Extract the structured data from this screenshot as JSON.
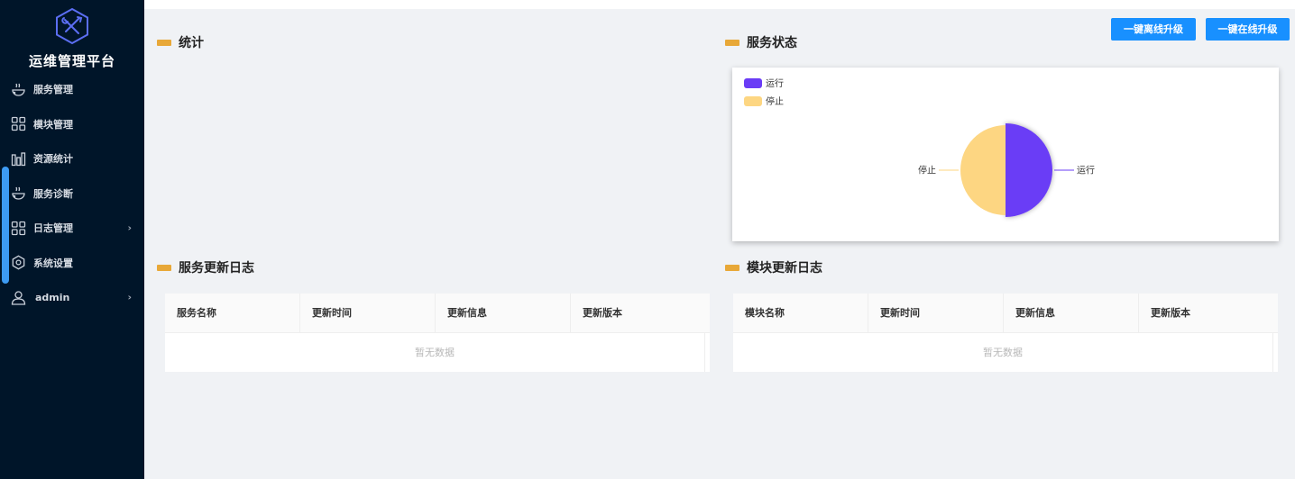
{
  "app": {
    "title": "运维管理平台"
  },
  "sidebar": {
    "items": [
      {
        "label": "服务管理",
        "icon": "service-bowl-icon",
        "has_arrow": false
      },
      {
        "label": "模块管理",
        "icon": "grid-icon",
        "has_arrow": false
      },
      {
        "label": "资源统计",
        "icon": "bar-chart-icon",
        "has_arrow": false
      },
      {
        "label": "服务诊断",
        "icon": "service-bowl-icon",
        "has_arrow": false
      },
      {
        "label": "日志管理",
        "icon": "grid-icon",
        "has_arrow": true
      },
      {
        "label": "系统设置",
        "icon": "gear-icon",
        "has_arrow": false
      },
      {
        "label": "admin",
        "icon": "user-icon",
        "has_arrow": true
      }
    ]
  },
  "toolbar": {
    "offline_upgrade": "一键离线升级",
    "online_upgrade": "一键在线升级"
  },
  "sections": {
    "stats": "统计",
    "service_status": "服务状态",
    "service_log": "服务更新日志",
    "module_log": "模块更新日志"
  },
  "chart_data": {
    "type": "pie",
    "title": "",
    "legend_position": "top-left",
    "slices": [
      {
        "name": "运行",
        "value": 1,
        "color": "#6a3cf6"
      },
      {
        "name": "停止",
        "value": 1,
        "color": "#fdd682"
      }
    ]
  },
  "service_table": {
    "columns": [
      "服务名称",
      "更新时间",
      "更新信息",
      "更新版本"
    ],
    "empty_text": "暂无数据"
  },
  "module_table": {
    "columns": [
      "模块名称",
      "更新时间",
      "更新信息",
      "更新版本"
    ],
    "empty_text": "暂无数据"
  },
  "colors": {
    "sidebar_bg": "#001529",
    "accent": "#1890ff",
    "section_bar": "#e8a838"
  }
}
